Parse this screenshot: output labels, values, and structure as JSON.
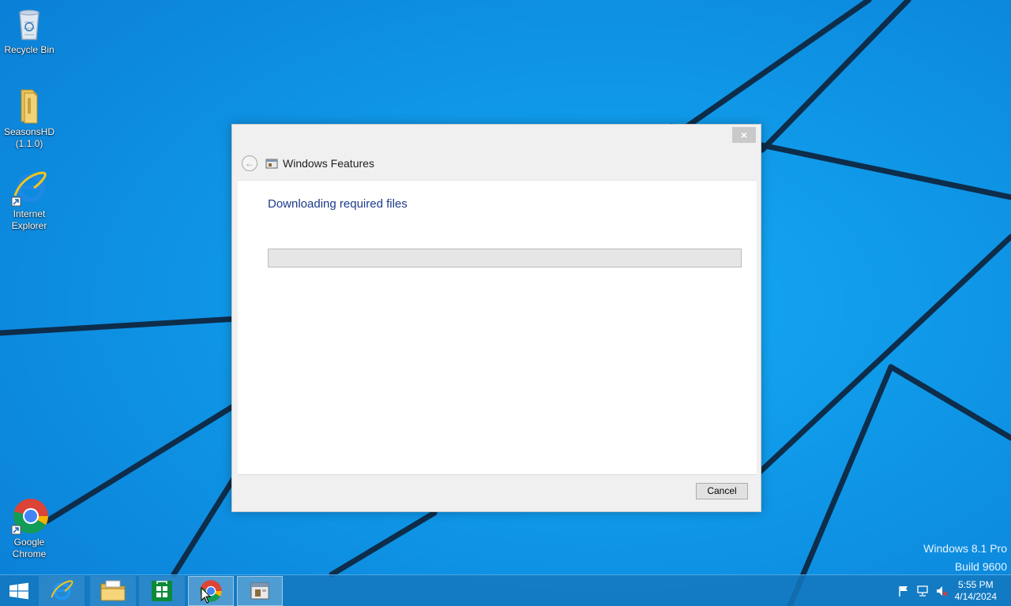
{
  "desktop": {
    "icons": [
      {
        "label": "Recycle Bin"
      },
      {
        "label": "SeasonsHD\n(1.1.0)"
      },
      {
        "label": "Internet\nExplorer"
      },
      {
        "label": "Google\nChrome"
      }
    ]
  },
  "dialog": {
    "title": "Windows Features",
    "close_glyph": "×",
    "back_glyph": "←",
    "heading": "Downloading required files",
    "progress": 0,
    "cancel_label": "Cancel"
  },
  "watermark": {
    "line1": "Windows 8.1 Pro",
    "line2": "Build 9600"
  },
  "taskbar": {
    "items": [
      "internet-explorer",
      "file-explorer",
      "store",
      "google-chrome",
      "windows-features"
    ],
    "clock_time": "5:55 PM",
    "clock_date": "4/14/2024"
  },
  "colors": {
    "desktop_bg": "#0a93e6",
    "heading": "#1c3a8a",
    "taskbar": "#1478be"
  }
}
